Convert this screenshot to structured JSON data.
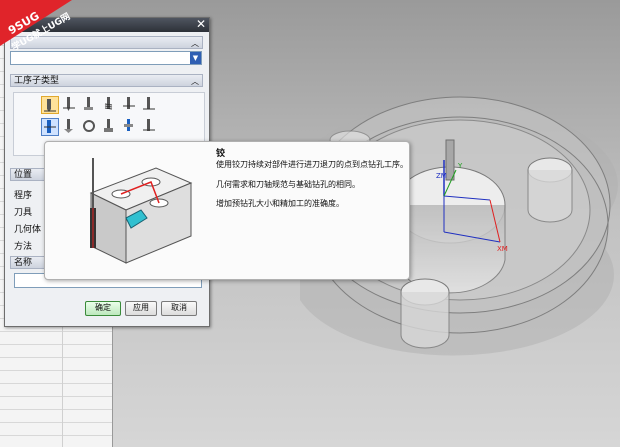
{
  "watermark": {
    "site": "9SUG",
    "slogan": "学UG就上UG网"
  },
  "dialog": {
    "section_subtype": "工序子类型",
    "section_location": "位置",
    "location_items": [
      "程序",
      "刀具",
      "几何体",
      "方法"
    ],
    "section_name": "名称",
    "buttons": {
      "ok": "确定",
      "apply": "应用",
      "cancel": "取消"
    }
  },
  "tooltip": {
    "title": "铰",
    "lines": [
      "使用铰刀持续对部件进行进刀退刀的点到点钻孔工序。",
      "几何需求和刀轴规范与基础钻孔的相同。",
      "增加预钻孔大小和精加工的准确度。"
    ]
  },
  "viewport": {
    "axis_z": "ZM",
    "axis_x": "XM",
    "axis_y": "Y"
  },
  "colors": {
    "accent_selected": "#ffe29a",
    "axis_x": "#e02020",
    "axis_z": "#2030c0"
  }
}
